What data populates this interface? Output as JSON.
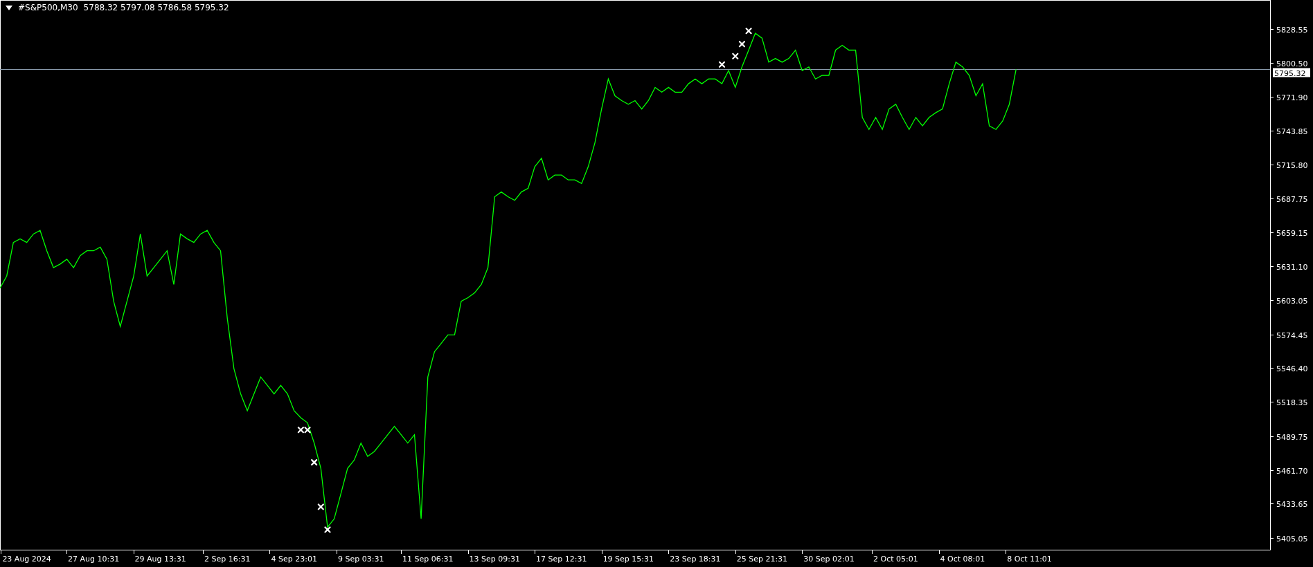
{
  "header": {
    "symbol": "#S&P500,M30",
    "quotes": "5788.32 5797.08 5786.58 5795.32"
  },
  "chart_data": {
    "type": "line",
    "ylim": [
      5395.3,
      5852.7
    ],
    "categories": [
      null,
      null,
      null,
      null,
      "23 Aug 2024",
      null,
      null,
      null,
      null,
      null,
      null,
      null,
      null,
      null,
      "27 Aug 10:31",
      null,
      null,
      null,
      null,
      null,
      null,
      null,
      null,
      null,
      "29 Aug 13:31",
      null,
      null,
      null,
      null,
      null,
      null,
      null,
      null,
      null,
      "2 Sep 16:31",
      null,
      null,
      null,
      null,
      null,
      null,
      null,
      null,
      null,
      "4 Sep 23:01",
      null,
      null,
      null,
      null,
      null,
      null,
      null,
      null,
      null,
      "9 Sep 03:31",
      null,
      null,
      null,
      null,
      null,
      null,
      null,
      null,
      null,
      "11 Sep 06:31",
      null,
      null,
      null,
      null,
      null,
      null,
      null,
      null,
      null,
      "13 Sep 09:31",
      null,
      null,
      null,
      null,
      null,
      null,
      null,
      null,
      null,
      "17 Sep 12:31",
      null,
      null,
      null,
      null,
      null,
      null,
      null,
      null,
      null,
      "19 Sep 15:31",
      null,
      null,
      null,
      null,
      null,
      null,
      null,
      null,
      null,
      "23 Sep 18:31",
      null,
      null,
      null,
      null,
      null,
      null,
      null,
      null,
      null,
      "25 Sep 21:31",
      null,
      null,
      null,
      null,
      null,
      null,
      null,
      null,
      null,
      "30 Sep 02:01",
      null,
      null,
      null,
      null,
      null,
      null,
      null,
      null,
      null,
      "2 Oct 05:01",
      null,
      null,
      null,
      null,
      null,
      null,
      null,
      null,
      null,
      "4 Oct 08:01",
      null,
      null,
      null,
      null,
      null,
      null,
      null,
      null,
      null,
      "8 Oct 11:01"
    ],
    "series": [
      {
        "color": "#00ff00",
        "values": [
          5613,
          5623,
          5651,
          5654,
          5651,
          5658,
          5661,
          5644,
          5630,
          5633,
          5637,
          5630,
          5640,
          5644,
          5644,
          5647,
          5637,
          5602,
          5581,
          5602,
          5623,
          5658,
          5623,
          5630,
          5637,
          5644,
          5616,
          5658,
          5654,
          5651,
          5658,
          5661,
          5651,
          5644,
          5588,
          5546,
          5525,
          5511,
          5525,
          5539,
          5532,
          5525,
          5532,
          5525,
          5511,
          5505,
          5501,
          5484,
          5463,
          5414,
          5421,
          5442,
          5463,
          5470,
          5484,
          5473,
          5477,
          5484,
          5491,
          5498,
          5491,
          5484,
          5491,
          5421,
          5539,
          5560,
          5567,
          5574,
          5574,
          5602,
          5605,
          5609,
          5616,
          5630,
          5689,
          5693,
          5689,
          5686,
          5693,
          5696,
          5714,
          5721,
          5703,
          5707,
          5707,
          5703,
          5703,
          5700,
          5714,
          5734,
          5762,
          5787,
          5773,
          5769,
          5766,
          5769,
          5762,
          5769,
          5780,
          5776,
          5780,
          5776,
          5776,
          5783,
          5787,
          5783,
          5787,
          5787,
          5783,
          5794,
          5780,
          5797,
          5811,
          5825,
          5821,
          5801,
          5804,
          5801,
          5804,
          5811,
          5794,
          5797,
          5787,
          5790,
          5790,
          5811,
          5815,
          5811,
          5811,
          5755,
          5745,
          5755,
          5745,
          5762,
          5766,
          5755,
          5745,
          5755,
          5748,
          5755,
          5759,
          5762,
          5783,
          5801,
          5797,
          5790,
          5773,
          5783,
          5748,
          5745,
          5752,
          5766,
          5795,
          null,
          null
        ]
      },
      {
        "type": "scatter",
        "color": "#ffffff",
        "values": [
          null,
          null,
          null,
          null,
          null,
          null,
          null,
          null,
          null,
          null,
          null,
          null,
          null,
          null,
          null,
          null,
          null,
          null,
          null,
          null,
          null,
          null,
          null,
          null,
          null,
          null,
          null,
          null,
          null,
          null,
          null,
          null,
          null,
          null,
          null,
          null,
          null,
          null,
          null,
          null,
          null,
          null,
          null,
          null,
          null,
          5495,
          5495,
          5468,
          5431,
          5412,
          null,
          null,
          null,
          null,
          null,
          null,
          null,
          null,
          null,
          null,
          null,
          null,
          null,
          null,
          null,
          null,
          null,
          null,
          null,
          null,
          null,
          null,
          null,
          null,
          null,
          null,
          null,
          null,
          null,
          null,
          null,
          null,
          null,
          null,
          null,
          null,
          null,
          null,
          null,
          null,
          null,
          null,
          null,
          null,
          null,
          null,
          null,
          null,
          null,
          null,
          null,
          null,
          null,
          null,
          null,
          null,
          null,
          null,
          5799,
          null,
          5806,
          5816,
          5827,
          null,
          null,
          null,
          null,
          null,
          null,
          null,
          null,
          null,
          null,
          null,
          null,
          null,
          null,
          null,
          null,
          null,
          null,
          null,
          null,
          null,
          null,
          null,
          null,
          null,
          null,
          null,
          null,
          null,
          null,
          null,
          null,
          null,
          null,
          null,
          null,
          null,
          null,
          null,
          null,
          null,
          null
        ]
      }
    ],
    "yticks": [
      {
        "value": 5828.55,
        "label": "5828.55"
      },
      {
        "value": 5800.5,
        "label": "5800.50"
      },
      {
        "value": 5771.9,
        "label": "5771.90"
      },
      {
        "value": 5743.85,
        "label": "5743.85"
      },
      {
        "value": 5715.8,
        "label": "5715.80"
      },
      {
        "value": 5687.75,
        "label": "5687.75"
      },
      {
        "value": 5659.15,
        "label": "5659.15"
      },
      {
        "value": 5631.1,
        "label": "5631.10"
      },
      {
        "value": 5603.05,
        "label": "5603.05"
      },
      {
        "value": 5574.45,
        "label": "5574.45"
      },
      {
        "value": 5546.4,
        "label": "5546.40"
      },
      {
        "value": 5518.35,
        "label": "5518.35"
      },
      {
        "value": 5489.75,
        "label": "5489.75"
      },
      {
        "value": 5461.7,
        "label": "5461.70"
      },
      {
        "value": 5433.65,
        "label": "5433.65"
      },
      {
        "value": 5405.05,
        "label": "5405.05"
      }
    ],
    "ref_lines": [
      {
        "axis": "y",
        "value": 5795.32,
        "label": "5795.32"
      }
    ]
  }
}
